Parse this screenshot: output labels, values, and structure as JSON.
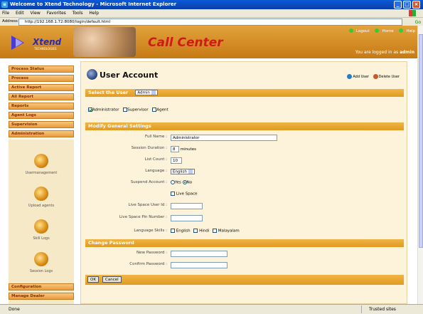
{
  "window": {
    "title": "Welcome to Xtend Technology - Microsoft Internet Explorer",
    "min": "_",
    "max": "□",
    "close": "×"
  },
  "menu": [
    "File",
    "Edit",
    "View",
    "Favorites",
    "Tools",
    "Help"
  ],
  "address": {
    "label": "Address",
    "url": "http://192.168.1.72:8080/login/default.html",
    "go": "Go"
  },
  "header": {
    "logo_text": "Xtend",
    "logo_sub": "TECHNOLOGIES",
    "brand": "Call Center",
    "links": [
      "Logout",
      "Home",
      "Help"
    ],
    "logged_in_prefix": "You are logged in as",
    "logged_in_user": "admin"
  },
  "nav": [
    "Process Status",
    "Process",
    "Active Report",
    "All Report",
    "Reports",
    "Agent Logs",
    "Supervision",
    "Administration"
  ],
  "subnav": [
    "Usermanagement",
    "Upload agents",
    "Skill Logs",
    "Session Logs"
  ],
  "nav_bottom": [
    "Configuration",
    "Manage Dealer"
  ],
  "page": {
    "title": "User Account",
    "add_user": "Add User",
    "delete_user": "Delete User"
  },
  "select_user": {
    "label": "Select the User",
    "value": "Admin"
  },
  "roles": [
    {
      "label": "Administrator",
      "checked": true
    },
    {
      "label": "Supervisor",
      "checked": false
    },
    {
      "label": "Agent",
      "checked": false
    }
  ],
  "general": {
    "heading": "Modify General Settings",
    "full_name_label": "Full Name :",
    "full_name": "Administrator",
    "session_duration_label": "Session Duration :",
    "session_duration": "8",
    "session_unit": "minutes",
    "list_count_label": "List Count :",
    "list_count": "10",
    "language_label": "Language :",
    "language": "English",
    "suspend_label": "Suspend Account :",
    "suspend_yes": "Yes",
    "suspend_no": "No",
    "live_space": "Live Space",
    "live_space_user_label": "Live Space User Id :",
    "live_space_pin_label": "Live Space Pin Number :",
    "language_skills_label": "Language Skills :",
    "skills": [
      "English",
      "Hindi",
      "Malayalam"
    ]
  },
  "password": {
    "heading": "Change Password",
    "new_label": "New Password :",
    "confirm_label": "Confirm Password :"
  },
  "buttons": {
    "ok": "OK",
    "cancel": "Cancel"
  },
  "status": {
    "left": "Done",
    "zone": "Trusted sites"
  }
}
